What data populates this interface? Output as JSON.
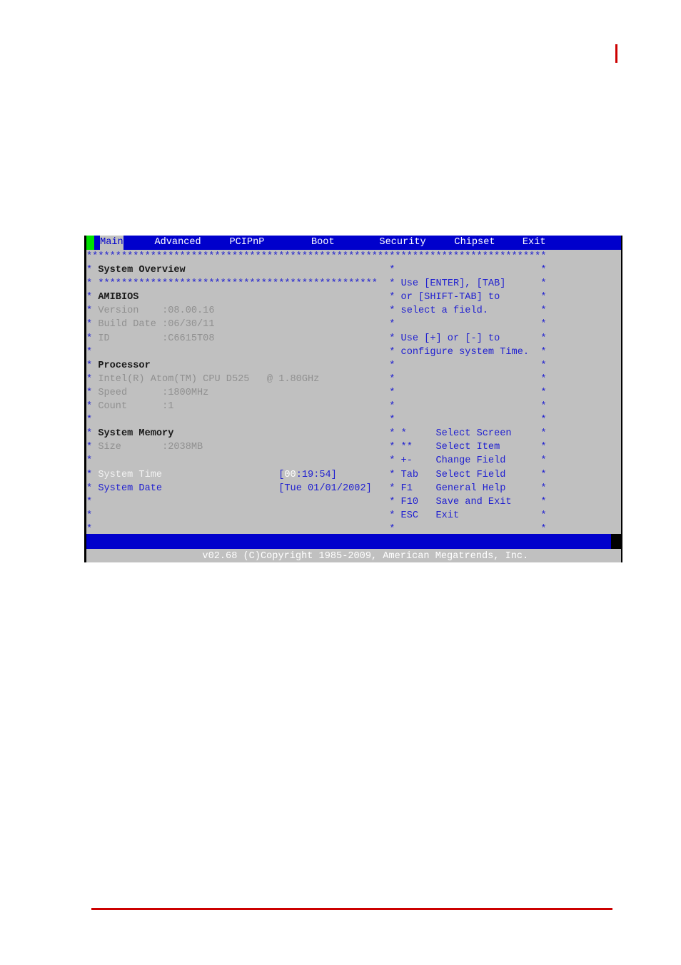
{
  "page": {
    "accent_red": "#cc0000",
    "bios_bg": "#c0c0c0",
    "bios_blue": "#0000cc",
    "cursor_green": "#00e000"
  },
  "menubar": {
    "items": [
      {
        "label": "Main",
        "active": true
      },
      {
        "label": "Advanced",
        "active": false
      },
      {
        "label": "PCIPnP",
        "active": false
      },
      {
        "label": "Boot",
        "active": false
      },
      {
        "label": "Security",
        "active": false
      },
      {
        "label": "Chipset",
        "active": false
      },
      {
        "label": "Exit",
        "active": false
      }
    ]
  },
  "separators": {
    "full_rule": "*******************************************************************************",
    "section_rule": "************************************************",
    "star": "*"
  },
  "main_panel": {
    "title": "System Overview",
    "sections": [
      {
        "heading": "AMIBIOS",
        "rows": [
          {
            "label": "Version",
            "value": ":08.00.16"
          },
          {
            "label": "Build Date",
            "value": ":06/30/11"
          },
          {
            "label": "ID",
            "value": ":C6615T08"
          }
        ]
      },
      {
        "heading": "Processor",
        "rows": [
          {
            "label": "Intel(R) Atom(TM) CPU D525   @ 1.80GHz",
            "value": ""
          },
          {
            "label": "Speed",
            "value": ":1800MHz"
          },
          {
            "label": "Count",
            "value": ":1"
          }
        ]
      },
      {
        "heading": "System Memory",
        "rows": [
          {
            "label": "Size",
            "value": ":2038MB"
          }
        ]
      }
    ],
    "fields": [
      {
        "label": "System Time",
        "selected": true,
        "open_bracket": "[",
        "value_highlight": "00",
        "value_rest": ":19:54",
        "close_bracket": "]"
      },
      {
        "label": "System Date",
        "selected": false,
        "open_bracket": "[",
        "value_highlight": "",
        "value_rest": "Tue 01/01/2002",
        "close_bracket": "]"
      }
    ]
  },
  "help_panel": {
    "lines": [
      "Use [ENTER], [TAB]",
      "or [SHIFT-TAB] to",
      "select a field.",
      "",
      "Use [+] or [-] to",
      "configure system Time.",
      "",
      "",
      "",
      "",
      ""
    ],
    "keys": [
      {
        "key": "*",
        "action": "Select Screen"
      },
      {
        "key": "**",
        "action": "Select Item"
      },
      {
        "key": "+-",
        "action": "Change Field"
      },
      {
        "key": "Tab",
        "action": "Select Field"
      },
      {
        "key": "F1",
        "action": "General Help"
      },
      {
        "key": "F10",
        "action": "Save and Exit"
      },
      {
        "key": "ESC",
        "action": "Exit"
      }
    ]
  },
  "footer": {
    "text": "v02.68 (C)Copyright 1985-2009, American Megatrends, Inc."
  }
}
